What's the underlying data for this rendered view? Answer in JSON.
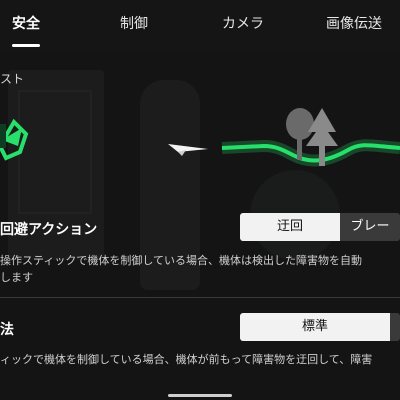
{
  "tabs": [
    {
      "label": "安全",
      "active": true
    },
    {
      "label": "制御",
      "active": false
    },
    {
      "label": "カメラ",
      "active": false
    },
    {
      "label": "画像伝送",
      "active": false
    }
  ],
  "section_label": "スト",
  "avoidance": {
    "title": "回避アクション",
    "description_line1": "操作スティックで機体を制御している場合、機体は検出した障害物を自動",
    "description_line2": "します",
    "options": [
      "迂回",
      "ブレー"
    ],
    "selected": "迂回"
  },
  "method": {
    "title": "法",
    "description": "ィックで機体を制御している場合、機体が前もって障害物を迂回して、障害",
    "options": [
      "標準",
      ""
    ],
    "selected": "標準"
  },
  "colors": {
    "accent_green": "#27e06b",
    "background": "#171717"
  },
  "icons": [
    "drone-shield-icon",
    "paper-plane-icon",
    "trees-icon"
  ]
}
